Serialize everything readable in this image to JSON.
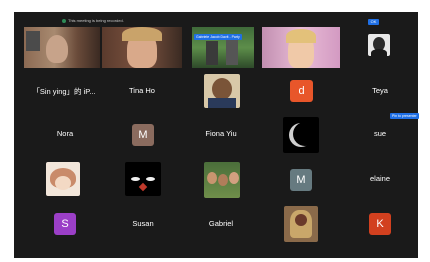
{
  "recording_banner": "This meeting is being recorded.",
  "ok_button": "OK",
  "video_chip": "Gabriele Jacob Davit - Party",
  "pin_chip": "Pin to presenter",
  "participants": {
    "sin_ying": "「Sin ying」的 iP...",
    "tina_ho": "Tina Ho",
    "teya": "Teya",
    "nora": "Nora",
    "fiona_yiu": "Fiona Yiu",
    "sue": "sue",
    "elaine": "elaine",
    "susan": "Susan",
    "gabriel": "Gabriel"
  },
  "avatars": {
    "d": {
      "letter": "d",
      "color": "#e8562a"
    },
    "m1": {
      "letter": "M",
      "color": "#8a6b5e"
    },
    "m2": {
      "letter": "M",
      "color": "#667a80"
    },
    "s": {
      "letter": "S",
      "color": "#9b3fc7"
    },
    "k": {
      "letter": "K",
      "color": "#d2401f"
    }
  }
}
